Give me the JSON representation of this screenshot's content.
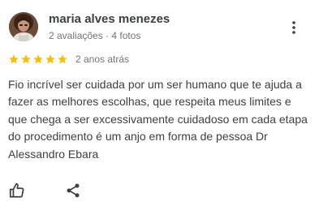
{
  "reviewer": {
    "name": "maria alves menezes",
    "meta": "2 avaliações · 4 fotos",
    "avatar_icon": "reviewer-photo"
  },
  "review": {
    "rating": 5,
    "rating_max": 5,
    "date": "2 anos atrás",
    "text": "Fio incrível ser cuidada por um ser humano que te ajuda a fazer as melhores escolhas, que respeita meus limites e que chega a ser excessivamente cuidadoso em cada etapa do procedimento é um anjo em forma de pessoa Dr Alessandro Ebara"
  },
  "actions": {
    "menu_icon": "more-vert-icon",
    "like_icon": "thumb-up-icon",
    "share_icon": "share-icon"
  },
  "colors": {
    "star": "#fbbc04",
    "text": "#3c4043",
    "secondary": "#70757a",
    "icon": "#3c4043"
  }
}
